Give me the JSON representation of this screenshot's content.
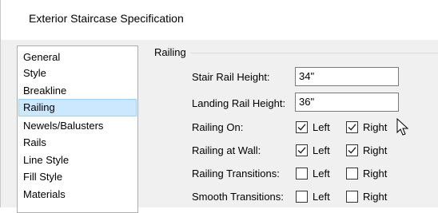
{
  "window": {
    "title": "Exterior Staircase Specification"
  },
  "sidebar": {
    "items": [
      {
        "label": "General",
        "selected": false
      },
      {
        "label": "Style",
        "selected": false
      },
      {
        "label": "Breakline",
        "selected": false
      },
      {
        "label": "Railing",
        "selected": true
      },
      {
        "label": "Newels/Balusters",
        "selected": false
      },
      {
        "label": "Rails",
        "selected": false
      },
      {
        "label": "Line Style",
        "selected": false
      },
      {
        "label": "Fill Style",
        "selected": false
      },
      {
        "label": "Materials",
        "selected": false
      }
    ]
  },
  "railing": {
    "group_label": "Railing",
    "stair_rail_height": {
      "label": "Stair Rail Height:",
      "value": "34\""
    },
    "landing_rail_height": {
      "label": "Landing Rail Height:",
      "value": "36\""
    },
    "checkbox_rows": [
      {
        "label": "Railing On:",
        "left_label": "Left",
        "left_checked": true,
        "right_label": "Right",
        "right_checked": true
      },
      {
        "label": "Railing at Wall:",
        "left_label": "Left",
        "left_checked": true,
        "right_label": "Right",
        "right_checked": true
      },
      {
        "label": "Railing Transitions:",
        "left_label": "Left",
        "left_checked": false,
        "right_label": "Right",
        "right_checked": false
      },
      {
        "label": "Smooth Transitions:",
        "left_label": "Left",
        "left_checked": false,
        "right_label": "Right",
        "right_checked": false
      }
    ]
  },
  "icons": {
    "check": "check-mark-icon",
    "cursor": "mouse-pointer-icon"
  }
}
